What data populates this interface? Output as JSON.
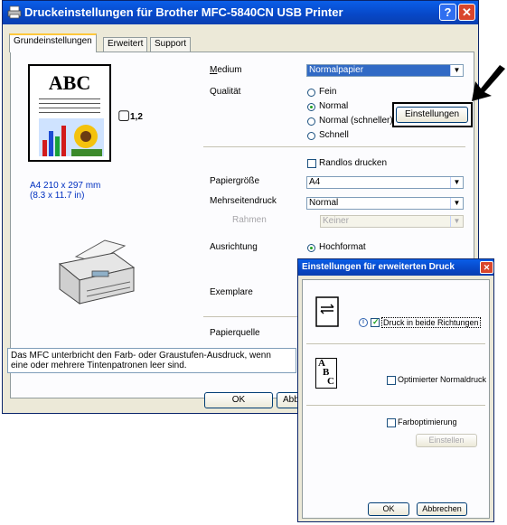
{
  "window": {
    "title": "Druckeinstellungen für Brother MFC-5840CN USB Printer",
    "help_glyph": "?",
    "close_glyph": "✕"
  },
  "tabs": [
    "Grundeinstellungen",
    "Erweitert",
    "Support"
  ],
  "preview": {
    "abc_text": "ABC",
    "copies_glyph": "▢",
    "copies_text": "1,2",
    "paper_size_line1": "A4 210 x 297 mm",
    "paper_size_line2": "(8.3 x 11.7 in)",
    "paper_size_color": "#0030c0"
  },
  "settings": {
    "medium_label": "Medium",
    "medium_value": "Normalpapier",
    "quality_label": "Qualität",
    "quality_options": [
      "Fein",
      "Normal",
      "Normal (schneller)",
      "Schnell"
    ],
    "quality_selected": "Normal",
    "einstellungen_button": "Einstellungen",
    "borderless_label": "Randlos drucken",
    "paper_size_label": "Papiergröße",
    "paper_size_value": "A4",
    "multipage_label": "Mehrseitendruck",
    "multipage_value": "Normal",
    "frame_label": "Rahmen",
    "frame_value": "Keiner",
    "orientation_label": "Ausrichtung",
    "orientation_value": "Hochformat",
    "copies_label": "Exemplare",
    "paper_source_label": "Papierquelle"
  },
  "info_text_line1": "Das MFC unterbricht den Farb- oder Graustufen-Ausdruck, wenn",
  "info_text_line2": "eine oder mehrere Tintenpatronen leer sind.",
  "footer": {
    "ok_label": "OK",
    "cancel_label_partial": "Abb"
  },
  "dialog": {
    "title": "Einstellungen für erweiterten Druck",
    "close_glyph": "✕",
    "bidirectional_label": "Druck in beide Richtungen",
    "bidirectional_checked": true,
    "info_glyph": "i",
    "optimized_plain_label": "Optimierter Normaldruck",
    "optimized_plain_checked": false,
    "color_optimization_label": "Farboptimierung",
    "color_optimization_checked": false,
    "einstellen_button": "Einstellen",
    "ok_label": "OK",
    "cancel_label": "Abbrechen",
    "abc_letters": [
      "A",
      "B",
      "C"
    ]
  },
  "colors": {
    "title_blue": "#0747c6",
    "selection_blue": "#316ac5",
    "callout_border": "#000000"
  }
}
